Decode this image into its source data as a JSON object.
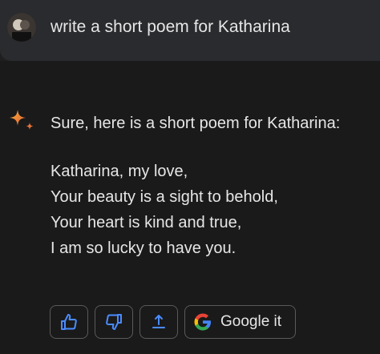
{
  "prompt": {
    "text": "write a short poem for Katharina"
  },
  "response": {
    "intro": "Sure, here is a short poem for Katharina:",
    "poem_lines": [
      "Katharina, my love,",
      "Your beauty is a sight to behold,",
      "Your heart is kind and true,",
      "I am so lucky to have you."
    ]
  },
  "actions": {
    "thumbs_up_icon": "thumbs-up-icon",
    "thumbs_down_icon": "thumbs-down-icon",
    "share_icon": "share-icon",
    "google_label": "Google it"
  },
  "colors": {
    "accent_blue": "#4a8cff",
    "sparkle_gradient_start": "#f2a12a",
    "sparkle_gradient_end": "#e86a35"
  }
}
